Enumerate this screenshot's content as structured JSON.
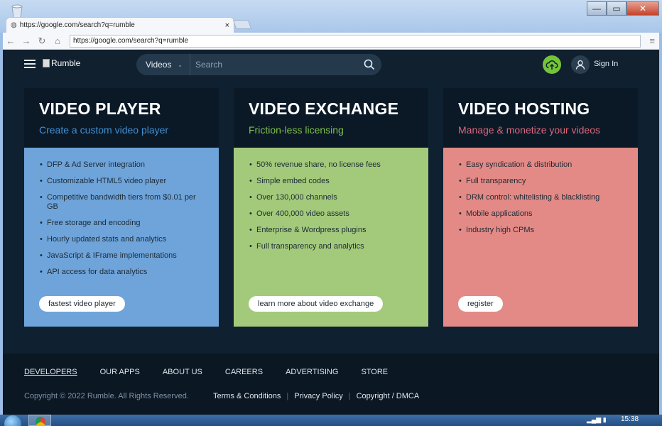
{
  "browser": {
    "tab_title": "https://google.com/search?q=rumble",
    "tab_close": "×",
    "address": "https://google.com/search?q=rumble",
    "controls": {
      "minimize": "—",
      "maximize": "▭",
      "close": "✕"
    }
  },
  "header": {
    "logo_text": "Rumble",
    "search_category": "Videos",
    "search_placeholder": "Search",
    "sign_in": "Sign In"
  },
  "cards": [
    {
      "title": "VIDEO PLAYER",
      "subtitle": "Create a custom video player",
      "subtitle_color": "#3f8fd3",
      "body_color": "#6fa4da",
      "items": [
        "DFP & Ad Server integration",
        "Customizable HTML5 video player",
        "Competitive bandwidth tiers from $0.01 per GB",
        "Free storage and encoding",
        "Hourly updated stats and analytics",
        "JavaScript & IFrame implementations",
        "API access for data analytics"
      ],
      "button": "fastest video player"
    },
    {
      "title": "VIDEO EXCHANGE",
      "subtitle": "Friction-less licensing",
      "subtitle_color": "#7ec04a",
      "body_color": "#a3ca7a",
      "items": [
        "50% revenue share, no license fees",
        "Simple embed codes",
        "Over 130,000 channels",
        "Over 400,000 video assets",
        "Enterprise & Wordpress plugins",
        "Full transparency and analytics"
      ],
      "button": "learn more about video exchange"
    },
    {
      "title": "VIDEO HOSTING",
      "subtitle": "Manage & monetize your videos",
      "subtitle_color": "#d9677a",
      "body_color": "#e48a86",
      "items": [
        "Easy syndication & distribution",
        "Full transparency",
        "DRM control: whitelisting & blacklisting",
        "Mobile applications",
        "Industry high CPMs"
      ],
      "button": "register"
    }
  ],
  "footer": {
    "links": [
      "DEVELOPERS",
      "OUR APPS",
      "ABOUT US",
      "CAREERS",
      "ADVERTISING",
      "STORE"
    ],
    "copyright": "Copyright © 2022 Rumble. All Rights Reserved.",
    "legal": [
      "Terms & Conditions",
      "Privacy Policy",
      "Copyright / DMCA"
    ]
  },
  "taskbar": {
    "time": "15:38"
  }
}
